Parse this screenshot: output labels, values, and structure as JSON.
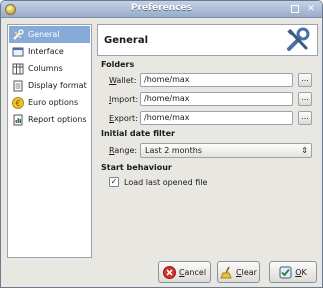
{
  "window": {
    "title": "Preferences"
  },
  "sidebar": {
    "items": [
      {
        "label": "General",
        "icon": "tools-icon",
        "selected": true
      },
      {
        "label": "Interface",
        "icon": "window-icon",
        "selected": false
      },
      {
        "label": "Columns",
        "icon": "columns-icon",
        "selected": false
      },
      {
        "label": "Display format",
        "icon": "document-icon",
        "selected": false
      },
      {
        "label": "Euro options",
        "icon": "euro-icon",
        "selected": false
      },
      {
        "label": "Report options",
        "icon": "report-icon",
        "selected": false
      }
    ]
  },
  "panel": {
    "title": "General",
    "folders": {
      "section_title": "Folders",
      "wallet": {
        "label_mnemonic": "W",
        "label_rest": "allet:",
        "value": "/home/max"
      },
      "import": {
        "label_mnemonic": "I",
        "label_rest": "mport:",
        "value": "/home/max"
      },
      "export": {
        "label_mnemonic": "E",
        "label_rest": "xport:",
        "value": "/home/max"
      },
      "browse_label": "..."
    },
    "date_filter": {
      "section_title": "Initial date filter",
      "range": {
        "label_mnemonic": "R",
        "label_rest": "ange:",
        "value": "Last 2 months"
      }
    },
    "start": {
      "section_title": "Start behaviour",
      "load_last": {
        "label": "Load last opened file",
        "checked": true
      }
    }
  },
  "buttons": {
    "cancel": {
      "mnemonic": "C",
      "rest": "ancel"
    },
    "clear": {
      "mnemonic": "C",
      "rest": "lear"
    },
    "ok": {
      "mnemonic": "O",
      "rest": "K"
    }
  },
  "colors": {
    "selection": "#86abd9",
    "titlebar": "#98abc8"
  }
}
